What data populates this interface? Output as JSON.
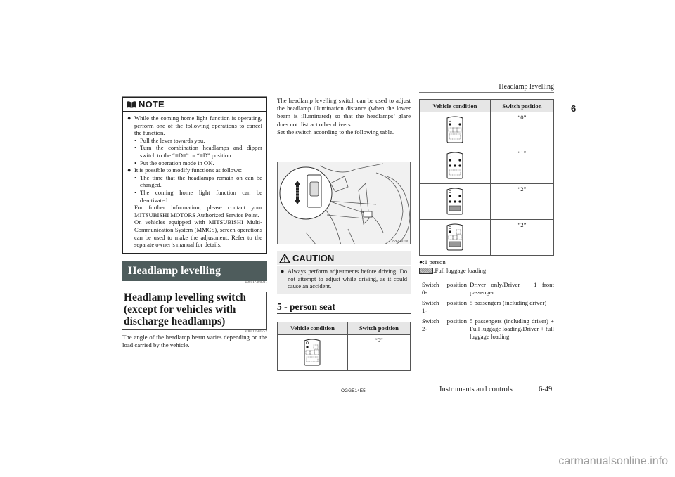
{
  "running_head": "Headlamp levelling",
  "chapter_number": "6",
  "note": {
    "title": "NOTE",
    "bullets": [
      {
        "text": "While the coming home light function is operating, perform one of the following operations to cancel the function.",
        "subs": [
          "Pull the lever towards you.",
          "Turn the combination headlamps and dipper switch to the “≡D≡” or “≡D” position.",
          "Put the operation mode in ON."
        ]
      },
      {
        "text": "It is possible to modify functions as follows:",
        "subs": [
          "The time that the headlamps remain on can be changed.",
          "The coming home light function can be deactivated."
        ],
        "paragraphs": [
          "For further information, please contact your MITSUBISHI MOTORS Authorized Service Point.",
          "On vehicles equipped with MITSUBISHI Multi-Communication System (MMCS), screen operations can be used to make the adjustment. Refer to the separate owner’s manual for details."
        ]
      }
    ]
  },
  "section": {
    "title": "Headlamp levelling",
    "code": "E00517400031"
  },
  "subsection": {
    "title": "Headlamp levelling switch (except for vehicles with discharge headlamps)",
    "code": "E00517501752",
    "intro": "The angle of the headlamp beam varies depending on the load carried by the vehicle."
  },
  "middle": {
    "paragraph1": "The headlamp levelling switch can be used to adjust the headlamp illumination distance (when the lower beam is illuminated) so that the headlamps’ glare does not distract other drivers.",
    "paragraph2": "Set the switch according to the following table.",
    "illustration_code": "AA0110190",
    "caution": {
      "title": "CAUTION",
      "text": "Always perform adjustments before driving. Do not attempt to adjust while driving, as it could cause an accident."
    },
    "five_seat_heading": "5 - person seat",
    "table": {
      "headers": [
        "Vehicle condition",
        "Switch position"
      ],
      "rows": [
        {
          "condition_icon": "driver-front-passenger-luggage",
          "position": "“0”"
        }
      ]
    }
  },
  "right": {
    "table": {
      "headers": [
        "Vehicle condition",
        "Switch position"
      ],
      "rows": [
        {
          "condition_icon": "two-front-seats",
          "position": "“0”"
        },
        {
          "condition_icon": "five-passengers",
          "position": "“1”"
        },
        {
          "condition_icon": "five-passengers-full-luggage",
          "position": "“2”"
        },
        {
          "condition_icon": "driver-full-luggage",
          "position": "“2”"
        }
      ]
    },
    "legend": {
      "person": "●:1 person",
      "luggage": ":Full luggage loading"
    },
    "positions": [
      {
        "label_a": "Switch",
        "label_b": "position",
        "label_c": "0-",
        "desc": "Driver only/Driver + 1 front passenger"
      },
      {
        "label_a": "Switch",
        "label_b": "position",
        "label_c": "1-",
        "desc": "5 passengers (including driver)"
      },
      {
        "label_a": "Switch",
        "label_b": "position",
        "label_c": "2-",
        "desc": "5 passengers (including driver) + Full luggage loading/Driver + full luggage loading"
      }
    ]
  },
  "footer": {
    "doc_code": "OGGE14E5",
    "section": "Instruments and controls",
    "page": "6-49"
  },
  "watermark": "carmanualsonline.info"
}
